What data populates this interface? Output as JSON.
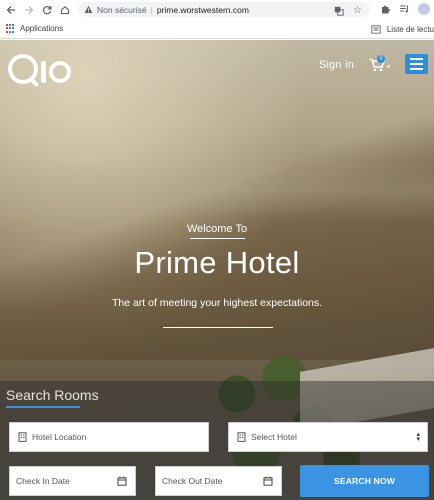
{
  "browser": {
    "security_label": "Non sécurisé",
    "url": "prime.worstwestern.com",
    "bookmarks": {
      "apps_label": "Applications",
      "reading_list_label": "Liste de lectu"
    }
  },
  "site": {
    "header": {
      "logo_text": "Qlo",
      "signin_label": "Sign in",
      "cart_count": "0"
    },
    "hero": {
      "welcome": "Welcome To",
      "title": "Prime Hotel",
      "tagline": "The art of meeting your highest expectations."
    },
    "search": {
      "heading": "Search Rooms",
      "location_placeholder": "Hotel Location",
      "hotel_select": "Select Hotel",
      "checkin_placeholder": "Check In Date",
      "checkout_placeholder": "Check Out Date",
      "button_label": "SEARCH NOW"
    }
  },
  "colors": {
    "accent": "#3b93e4",
    "menu_button": "#2d8ee0"
  }
}
